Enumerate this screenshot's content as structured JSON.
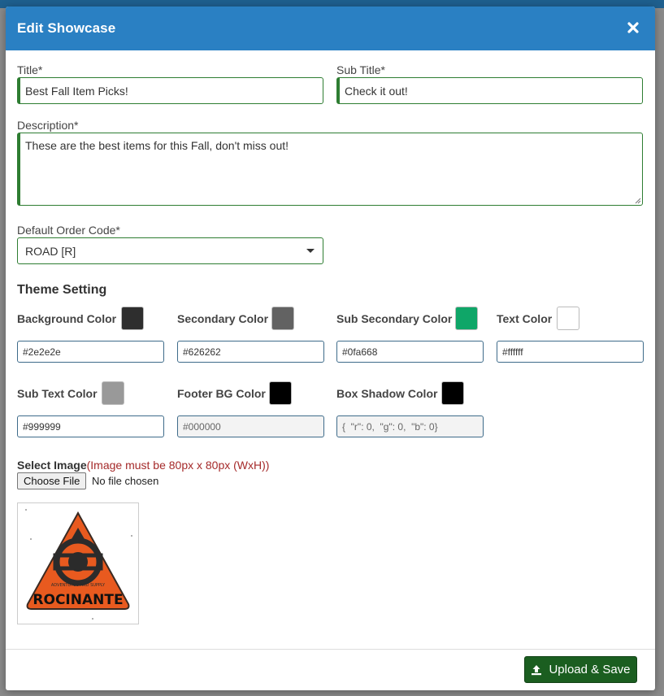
{
  "modal": {
    "title": "Edit Showcase"
  },
  "form": {
    "title_label": "Title*",
    "title_value": "Best Fall Item Picks!",
    "subtitle_label": "Sub Title*",
    "subtitle_value": "Check it out!",
    "description_label": "Description*",
    "description_value": "These are the best items for this Fall, don't miss out!",
    "order_code_label": "Default Order Code*",
    "order_code_value": "ROAD [R]"
  },
  "theme": {
    "section_title": "Theme Setting",
    "colors": [
      {
        "label": "Background Color",
        "value": "#2e2e2e",
        "swatch": "#2e2e2e"
      },
      {
        "label": "Secondary Color",
        "value": "#626262",
        "swatch": "#626262"
      },
      {
        "label": "Sub Secondary Color",
        "value": "#0fa668",
        "swatch": "#0fa668"
      },
      {
        "label": "Text Color",
        "value": "#ffffff",
        "swatch": "#ffffff"
      },
      {
        "label": "Sub Text Color",
        "value": "#999999",
        "swatch": "#999999"
      },
      {
        "label": "Footer BG Color",
        "value": "#000000",
        "swatch": "#000000"
      },
      {
        "label": "Box Shadow Color",
        "value": "{  \"r\": 0,  \"g\": 0,  \"b\": 0}",
        "swatch": "#000000"
      }
    ]
  },
  "image": {
    "label": "Select Image",
    "hint": "(Image must be 80px x 80px (WxH))",
    "choose_button": "Choose File",
    "file_status": "No file chosen",
    "preview_logo_text": "ROCINANTE",
    "preview_small_text": "ADVENTURES AND SUPPLY"
  },
  "footer": {
    "save_label": "Upload & Save"
  },
  "colors": {
    "header": "#2a80c3",
    "valid_border": "#2e7d32",
    "save_button": "#1b5e20",
    "hint_text": "#a52a2a"
  }
}
